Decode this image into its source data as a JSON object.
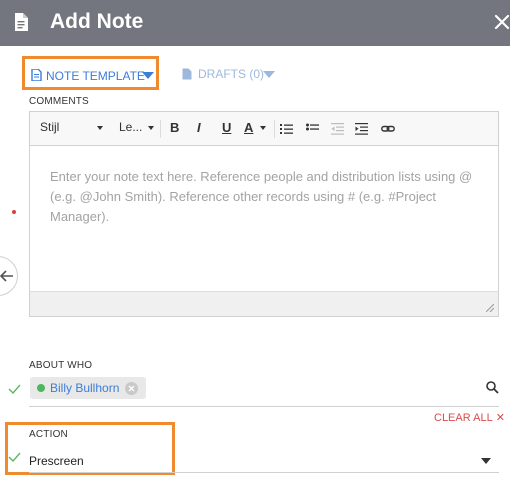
{
  "dialog": {
    "title": "Add Note",
    "title_icon": "document-icon",
    "close_icon": "close-icon"
  },
  "tabs": {
    "note_template": {
      "label": "NOTE TEMPLATE",
      "icon": "document-icon",
      "caret": "caret-down-icon"
    },
    "drafts": {
      "label": "DRAFTS (0)",
      "icon": "document-icon",
      "caret": "caret-down-icon"
    }
  },
  "comments": {
    "label": "COMMENTS",
    "toolbar": {
      "style_dropdown": "Stijl",
      "size_dropdown": "Le...",
      "bold": "B",
      "italic": "I",
      "underline": "U",
      "font_color": "A",
      "buttons": [
        "numbered-list",
        "bulleted-list",
        "decrease-indent",
        "increase-indent",
        "link"
      ]
    },
    "placeholder": "Enter your note text here. Reference people and distribution lists using @ (e.g. @John Smith). Reference other records using # (e.g. #Project Manager)."
  },
  "about_who": {
    "label": "ABOUT WHO",
    "chip": {
      "name": "Billy Bullhorn",
      "status_color": "#4cb85c"
    },
    "clear_all": "CLEAR ALL",
    "clear_all_icon": "close-icon"
  },
  "action": {
    "label": "ACTION",
    "value": "Prescreen"
  },
  "colors": {
    "header_bg": "#73767e",
    "accent_blue": "#3b7dd8",
    "highlight_orange": "#f08a2c",
    "required_red": "#d94040",
    "valid_green": "#5cb85c"
  }
}
